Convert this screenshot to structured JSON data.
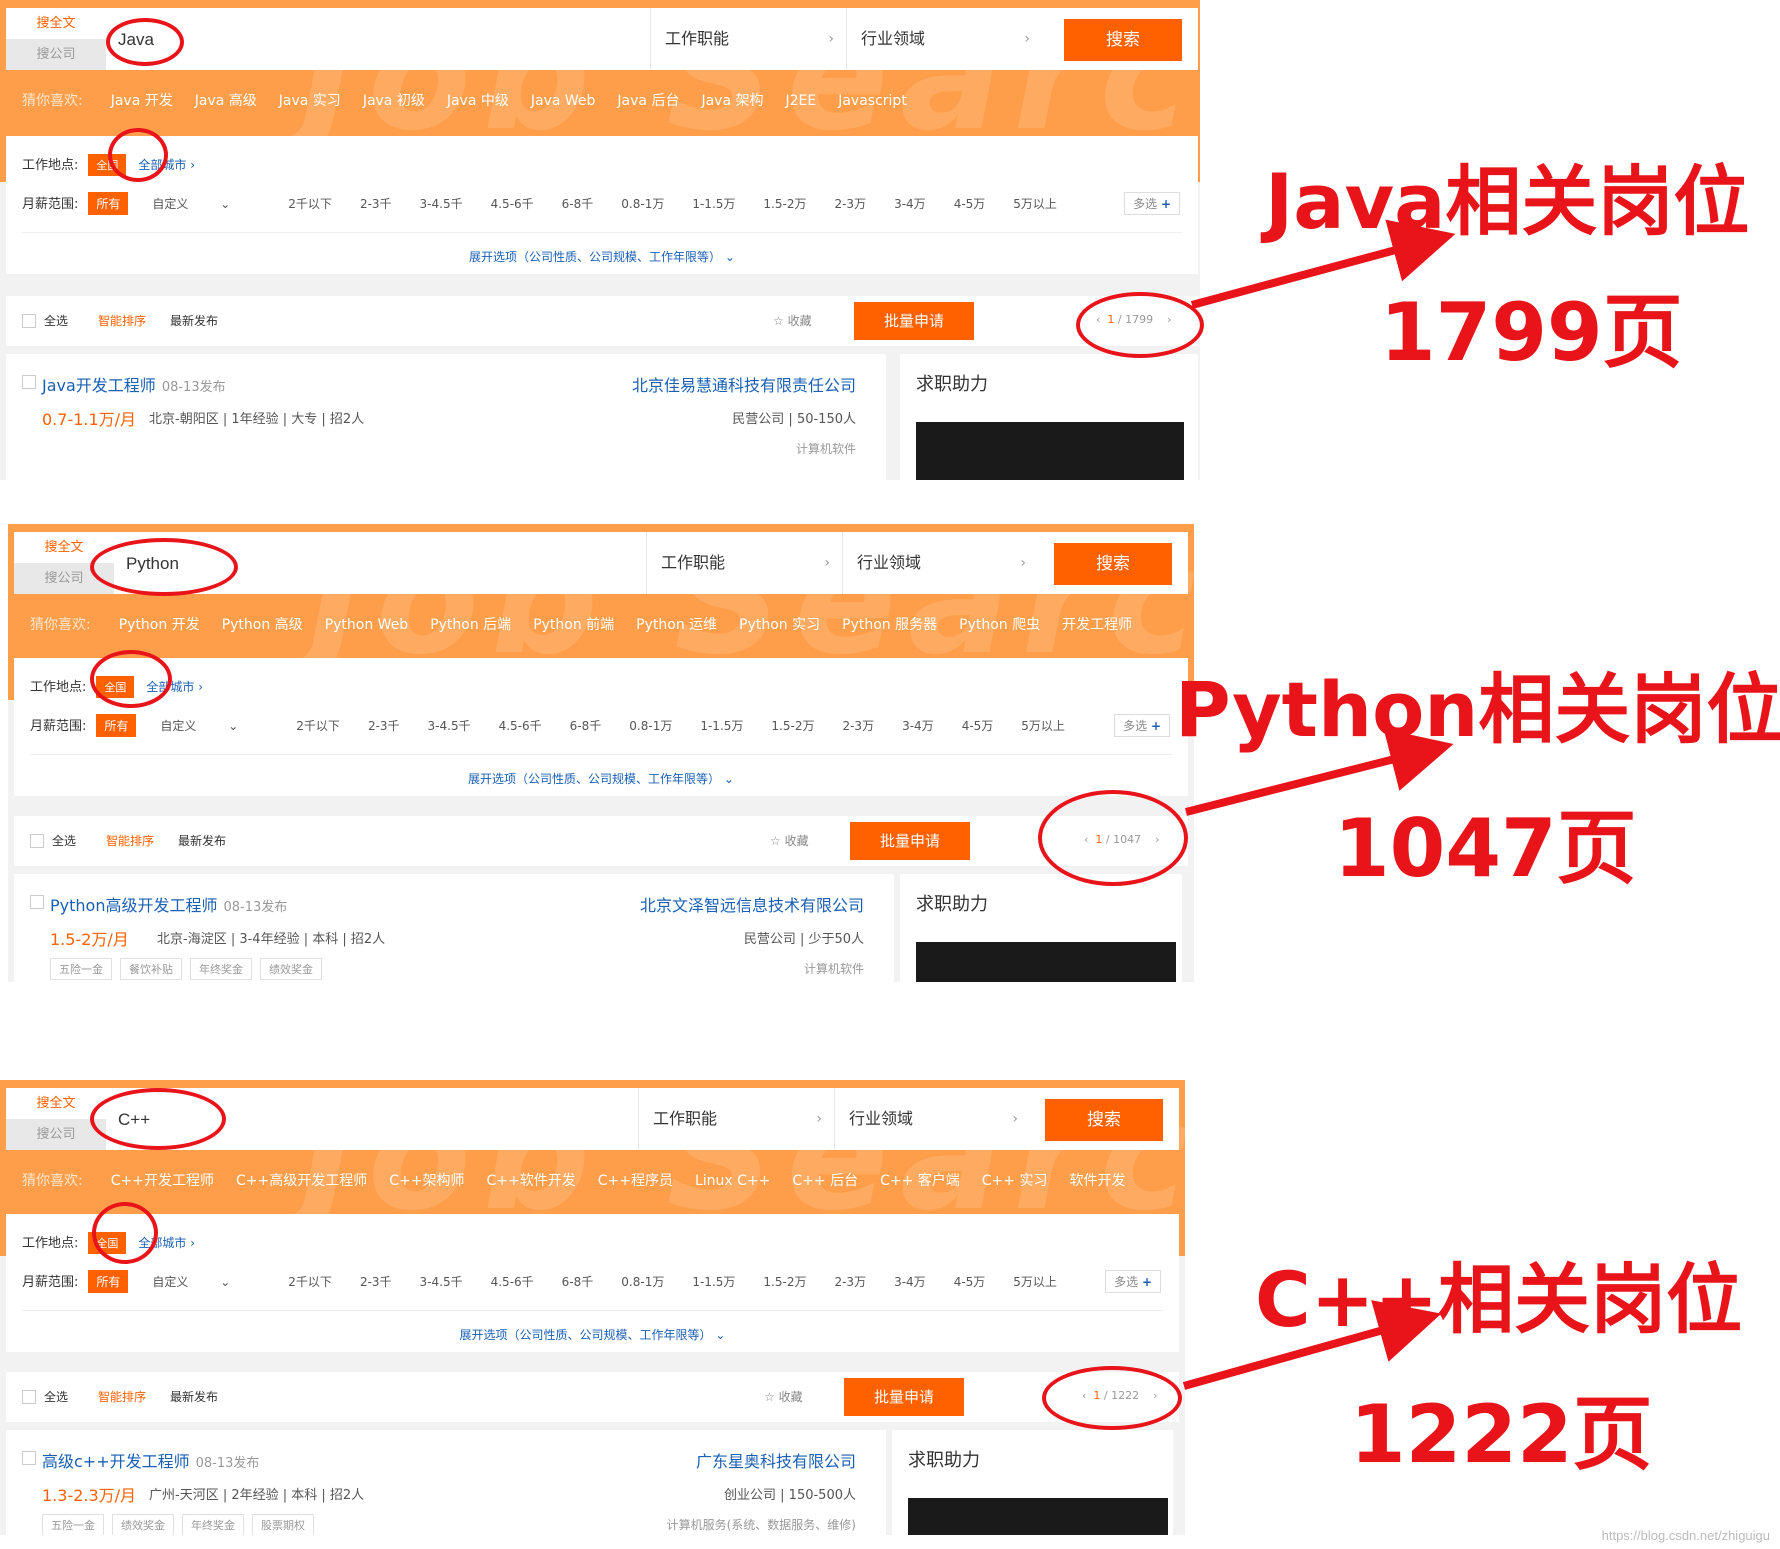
{
  "ui": {
    "mode_full": "搜全文",
    "mode_company": "搜公司",
    "dropdown_function": "工作职能",
    "dropdown_industry": "行业领域",
    "search_button": "搜索",
    "guess_label": "猜你喜欢:",
    "location_label": "工作地点:",
    "location_all": "全国",
    "all_cities": "全部城市",
    "salary_label": "月薪范围:",
    "salary_all": "所有",
    "custom": "自定义",
    "salary_options": [
      "2千以下",
      "2-3千",
      "3-4.5千",
      "4.5-6千",
      "6-8千",
      "0.8-1万",
      "1-1.5万",
      "1.5-2万",
      "2-3万",
      "3-4万",
      "4-5万",
      "5万以上"
    ],
    "multi_select": "多选",
    "expand_options": "展开选项（公司性质、公司规模、工作年限等）",
    "select_all": "全选",
    "sort_smart": "智能排序",
    "sort_latest": "最新发布",
    "favorite": "收藏",
    "batch_apply": "批量申请",
    "side_title": "求职助力",
    "watermark": "Job Search"
  },
  "panels": [
    {
      "query": "Java",
      "guess": [
        "Java 开发",
        "Java 高级",
        "Java 实习",
        "Java 初级",
        "Java 中级",
        "Java Web",
        "Java 后台",
        "Java 架构",
        "J2EE",
        "Javascript"
      ],
      "page_current": "1",
      "page_total": "1799",
      "job": {
        "title": "Java开发工程师",
        "posted": "08-13发布",
        "company": "北京佳易慧通科技有限责任公司",
        "salary": "0.7-1.1万/月",
        "meta": "北京-朝阳区 | 1年经验 | 大专 | 招2人",
        "company_meta": "民营公司 | 50-150人",
        "industry": "计算机软件",
        "welfare": []
      },
      "annotation": {
        "title": "Java相关岗位",
        "pages": "1799页"
      }
    },
    {
      "query": "Python",
      "guess": [
        "Python 开发",
        "Python 高级",
        "Python Web",
        "Python 后端",
        "Python 前端",
        "Python 运维",
        "Python 实习",
        "Python 服务器",
        "Python 爬虫",
        "开发工程师"
      ],
      "page_current": "1",
      "page_total": "1047",
      "job": {
        "title": "Python高级开发工程师",
        "posted": "08-13发布",
        "company": "北京文泽智远信息技术有限公司",
        "salary": "1.5-2万/月",
        "meta": "北京-海淀区 | 3-4年经验 | 本科 | 招2人",
        "company_meta": "民营公司 | 少于50人",
        "industry": "计算机软件",
        "welfare": [
          "五险一金",
          "餐饮补贴",
          "年终奖金",
          "绩效奖金"
        ]
      },
      "annotation": {
        "title": "Python相关岗位",
        "pages": "1047页"
      }
    },
    {
      "query": "C++",
      "guess": [
        "C++开发工程师",
        "C++高级开发工程师",
        "C++架构师",
        "C++软件开发",
        "C++程序员",
        "Linux C++",
        "C++ 后台",
        "C++ 客户端",
        "C++ 实习",
        "软件开发"
      ],
      "page_current": "1",
      "page_total": "1222",
      "job": {
        "title": "高级c++开发工程师",
        "posted": "08-13发布",
        "company": "广东星奥科技有限公司",
        "salary": "1.3-2.3万/月",
        "meta": "广州-天河区 | 2年经验 | 本科 | 招2人",
        "company_meta": "创业公司 | 150-500人",
        "industry": "计算机服务(系统、数据服务、维修)",
        "welfare": [
          "五险一金",
          "绩效奖金",
          "年终奖金",
          "股票期权"
        ]
      },
      "annotation": {
        "title": "C++相关岗位",
        "pages": "1222页"
      }
    }
  ],
  "footer": "https://blog.csdn.net/zhiguigu"
}
